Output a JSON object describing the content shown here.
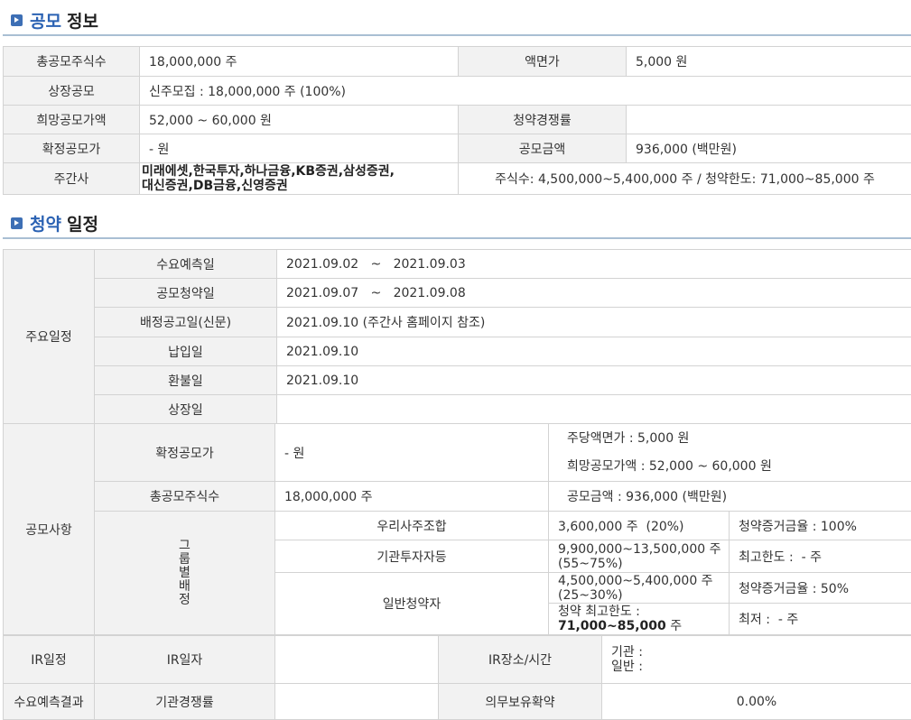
{
  "section1": {
    "highlight": "공모",
    "rest": "정보"
  },
  "info": {
    "total_shares_label": "총공모주식수",
    "total_shares": "18,000,000 주",
    "par_label": "액면가",
    "par": "5,000 원",
    "listing_label": "상장공모",
    "listing": "신주모집 : 18,000,000 주 (100%)",
    "desired_price_label": "희망공모가액",
    "desired_price": "52,000 ~ 60,000 원",
    "competition_label": "청약경쟁률",
    "competition": "",
    "confirmed_price_label": "확정공모가",
    "confirmed_price": "- 원",
    "amount_label": "공모금액",
    "amount": "936,000 (백만원)",
    "underwriter_label": "주간사",
    "underwriter_line1": "미래에셋,한국투자,하나금융,KB증권,삼성증권,",
    "underwriter_line2": "대신증권,DB금융,신영증권",
    "underwriter_detail": "주식수: 4,500,000~5,400,000 주   /   청약한도: 71,000~85,000 주"
  },
  "section2": {
    "highlight": "청약",
    "rest": "일정"
  },
  "schedule": {
    "main_label": "주요일정",
    "rows": [
      {
        "label": "수요예측일",
        "value": "2021.09.02   ~   2021.09.03"
      },
      {
        "label": "공모청약일",
        "value": "2021.09.07   ~   2021.09.08"
      },
      {
        "label": "배정공고일(신문)",
        "value": "2021.09.10 (주간사 홈페이지 참조)"
      },
      {
        "label": "납입일",
        "value": "2021.09.10"
      },
      {
        "label": "환불일",
        "value": "2021.09.10"
      },
      {
        "label": "상장일",
        "value": ""
      }
    ]
  },
  "offering": {
    "label": "공모사항",
    "confirmed_label": "확정공모가",
    "confirmed": "- 원",
    "par_line": "주당액면가 :  5,000 원",
    "desired_line": "희망공모가액 :  52,000 ~ 60,000 원",
    "total_label": "총공모주식수",
    "total": "18,000,000 주",
    "amount_line": "공모금액 : 936,000 (백만원)",
    "group_chars": [
      "그",
      "룹",
      "별",
      "배",
      "정"
    ],
    "employee_label": "우리사주조합",
    "employee_shares": "3,600,000 주  (20%)",
    "employee_rate": "청약증거금율 : 100%",
    "inst_label": "기관투자자등",
    "inst_shares1": "9,900,000~13,500,000 주",
    "inst_shares2": "(55~75%)",
    "inst_limit": "최고한도 :  - 주",
    "retail_label": "일반청약자",
    "retail_shares1": "4,500,000~5,400,000 주",
    "retail_shares2": "(25~30%)",
    "retail_rate": "청약증거금율 : 50%",
    "retail_limit_label": "청약 최고한도 :",
    "retail_limit": "71,000~85,000",
    "retail_limit_unit": " 주",
    "retail_min": "최저 :  - 주"
  },
  "ir": {
    "label": "IR일정",
    "date_label": "IR일자",
    "date": "",
    "place_label": "IR장소/시간",
    "inst": "기관 :",
    "retail": "일반 :"
  },
  "demand": {
    "label": "수요예측결과",
    "competition_label": "기관경쟁률",
    "competition": "",
    "lockup_label": "의무보유확약",
    "lockup": "0.00%"
  }
}
